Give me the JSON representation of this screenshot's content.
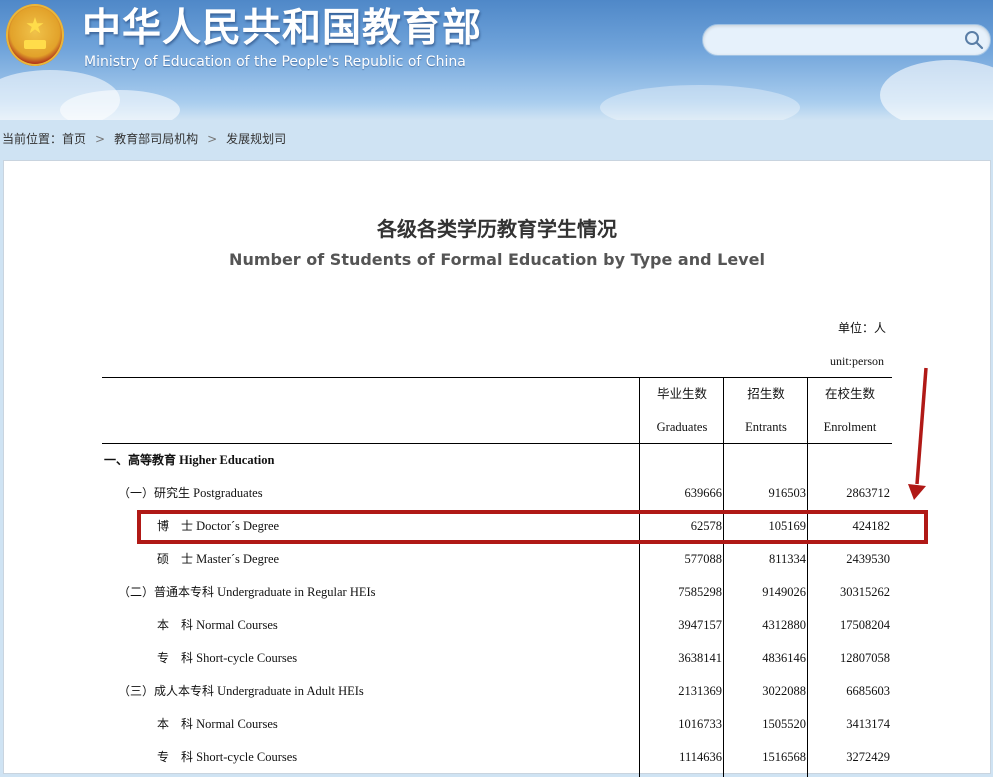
{
  "header": {
    "title": "中华人民共和国教育部",
    "subtitle": "Ministry of Education of the People's Republic of China",
    "search_placeholder": ""
  },
  "breadcrumb": {
    "prefix": "当前位置：",
    "items": [
      "首页",
      "教育部司局机构",
      "发展规划司"
    ],
    "separator": ">"
  },
  "document": {
    "title_cn": "各级各类学历教育学生情况",
    "title_en": "Number of Students of Formal Education by Type and Level",
    "unit_cn": "单位：人",
    "unit_en": "unit:person",
    "columns": [
      {
        "cn": "毕业生数",
        "en": "Graduates"
      },
      {
        "cn": "招生数",
        "en": "Entrants"
      },
      {
        "cn": "在校生数",
        "en": "Enrolment"
      }
    ],
    "rows": [
      {
        "label_cn": "一、高等教育",
        "label_en": "Higher Education",
        "level": 0,
        "values": [
          "",
          "",
          ""
        ]
      },
      {
        "label_cn": "（一）研究生",
        "label_en": "Postgraduates",
        "level": 1,
        "values": [
          "639666",
          "916503",
          "2863712"
        ]
      },
      {
        "label_cn": "博　士",
        "label_en": "Doctor´s Degree",
        "level": 2,
        "values": [
          "62578",
          "105169",
          "424182"
        ]
      },
      {
        "label_cn": "硕　士",
        "label_en": "Master´s Degree",
        "level": 2,
        "values": [
          "577088",
          "811334",
          "2439530"
        ]
      },
      {
        "label_cn": "（二）普通本专科",
        "label_en": "Undergraduate in Regular HEIs",
        "level": 1,
        "values": [
          "7585298",
          "9149026",
          "30315262"
        ]
      },
      {
        "label_cn": "本　科",
        "label_en": "Normal Courses",
        "level": 2,
        "values": [
          "3947157",
          "4312880",
          "17508204"
        ]
      },
      {
        "label_cn": "专　科",
        "label_en": "Short-cycle Courses",
        "level": 2,
        "values": [
          "3638141",
          "4836146",
          "12807058"
        ]
      },
      {
        "label_cn": "（三）成人本专科",
        "label_en": "Undergraduate in Adult HEIs",
        "level": 1,
        "values": [
          "2131369",
          "3022088",
          "6685603"
        ]
      },
      {
        "label_cn": "本　科",
        "label_en": "Normal Courses",
        "level": 2,
        "values": [
          "1016733",
          "1505520",
          "3413174"
        ]
      },
      {
        "label_cn": "专　科",
        "label_en": "Short-cycle Courses",
        "level": 2,
        "values": [
          "1114636",
          "1516568",
          "3272429"
        ]
      }
    ]
  },
  "colors": {
    "banner": "#4f88c8",
    "highlight": "#b01916"
  },
  "icons": [
    "national-emblem-icon",
    "search-icon",
    "chevron-right-icon",
    "red-arrow-icon"
  ]
}
